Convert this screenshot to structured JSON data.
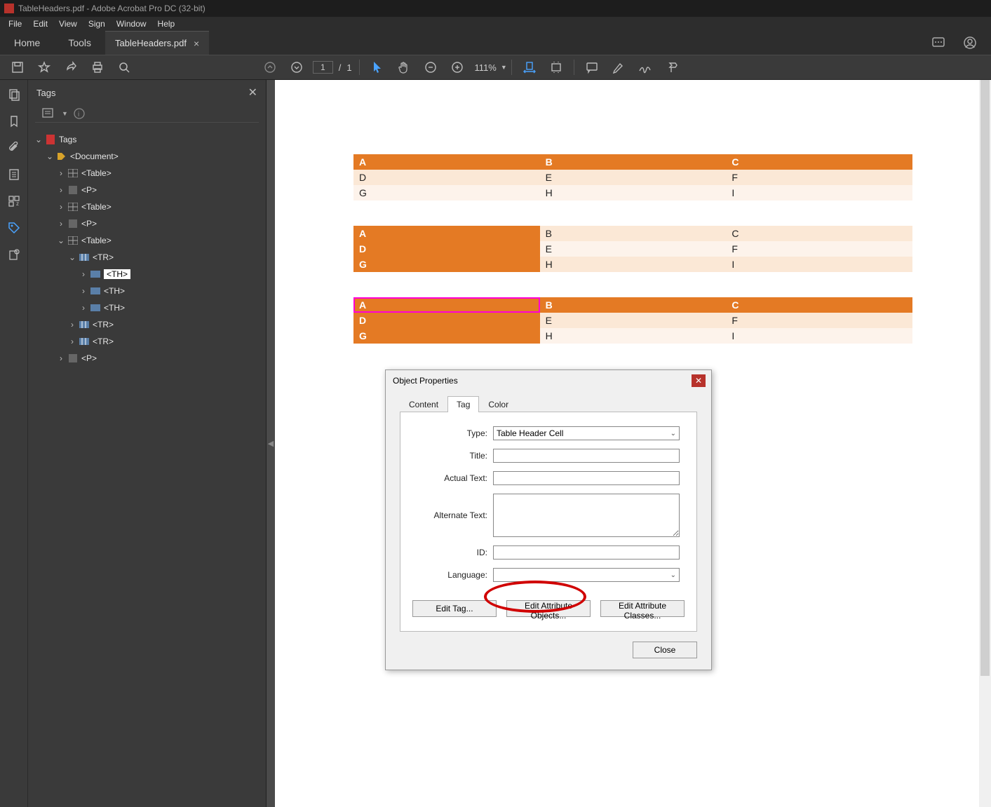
{
  "app": {
    "title": "TableHeaders.pdf - Adobe Acrobat Pro DC (32-bit)"
  },
  "menubar": [
    "File",
    "Edit",
    "View",
    "Sign",
    "Window",
    "Help"
  ],
  "tabs": {
    "home": "Home",
    "tools": "Tools",
    "doc": "TableHeaders.pdf"
  },
  "toolbar": {
    "page_current": "1",
    "page_sep": "/",
    "page_total": "1",
    "zoom": "111%"
  },
  "panel": {
    "title": "Tags"
  },
  "tree": {
    "root": "Tags",
    "doc": "<Document>",
    "t1": "<Table>",
    "p1": "<P>",
    "t2": "<Table>",
    "p2": "<P>",
    "t3": "<Table>",
    "tr1": "<TR>",
    "th1": "<TH>",
    "th2": "<TH>",
    "th3": "<TH>",
    "tr2": "<TR>",
    "tr3": "<TR>",
    "p3": "<P>"
  },
  "tables": {
    "t1": [
      [
        "A",
        "B",
        "C"
      ],
      [
        "D",
        "E",
        "F"
      ],
      [
        "G",
        "H",
        "I"
      ]
    ],
    "t2": [
      [
        "A",
        "B",
        "C"
      ],
      [
        "D",
        "E",
        "F"
      ],
      [
        "G",
        "H",
        "I"
      ]
    ],
    "t3": [
      [
        "A",
        "B",
        "C"
      ],
      [
        "D",
        "E",
        "F"
      ],
      [
        "G",
        "H",
        "I"
      ]
    ]
  },
  "dialog": {
    "title": "Object Properties",
    "tabs": {
      "content": "Content",
      "tag": "Tag",
      "color": "Color"
    },
    "labels": {
      "type": "Type:",
      "title": "Title:",
      "actual": "Actual Text:",
      "alt": "Alternate Text:",
      "id": "ID:",
      "lang": "Language:"
    },
    "type_value": "Table Header Cell",
    "buttons": {
      "edit_tag": "Edit Tag...",
      "edit_attr": "Edit Attribute Objects...",
      "edit_cls": "Edit Attribute Classes...",
      "close": "Close"
    }
  }
}
